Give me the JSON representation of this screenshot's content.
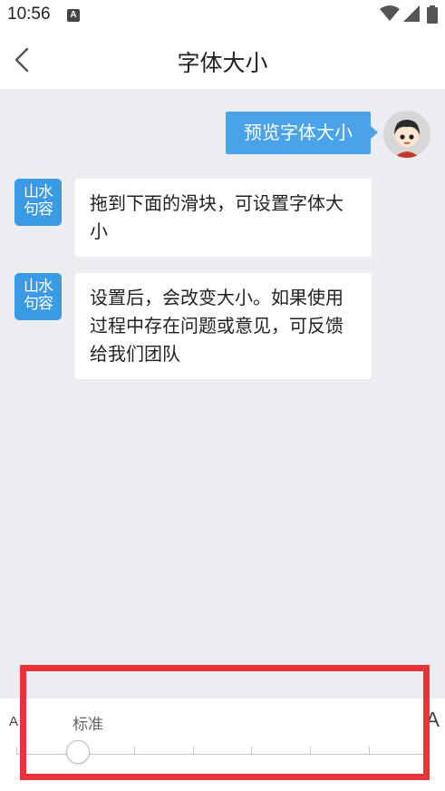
{
  "status_bar": {
    "time": "10:56",
    "notification_badge": "A",
    "icons": [
      "wifi-icon",
      "signal-icon",
      "battery-icon"
    ]
  },
  "header": {
    "back_icon": "chevron-left-icon",
    "title": "字体大小"
  },
  "chat": {
    "user_message": "预览字体大小",
    "bot_avatar_text": [
      "山水",
      "句容"
    ],
    "bot_messages": [
      "拖到下面的滑块，可设置字体大小",
      "设置后，会改变大小。如果使用过程中存在问题或意见，可反馈给我们团队"
    ]
  },
  "font_slider": {
    "small_label": "A",
    "large_label": "A",
    "current_label": "标准",
    "selected_step": 2,
    "step_count": 8
  },
  "colors": {
    "accent": "#4aa3e8",
    "bot_avatar": "#3b9ae4",
    "chat_background": "#ecedf1",
    "highlight": "#e8333a"
  }
}
